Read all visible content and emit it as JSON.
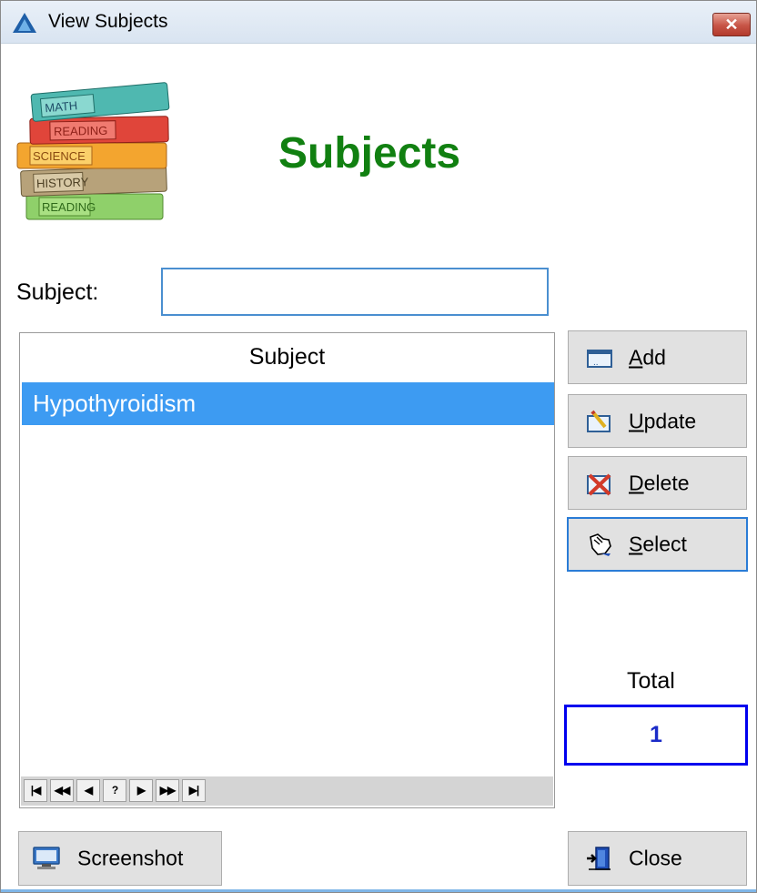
{
  "window": {
    "title": "View Subjects",
    "close_glyph": "✕"
  },
  "logo": {
    "book_labels": [
      "MATH",
      "READING",
      "SCIENCE",
      "HISTORY",
      "READING"
    ]
  },
  "heading": "Subjects",
  "subject_field": {
    "label": "Subject:",
    "value": "",
    "placeholder": ""
  },
  "grid": {
    "column_header": "Subject",
    "rows": [
      {
        "subject": "Hypothyroidism",
        "selected": true
      }
    ],
    "navigator": [
      "|◀",
      "◀◀",
      "◀",
      "?",
      "▶",
      "▶▶",
      "▶|"
    ]
  },
  "buttons": {
    "add": {
      "label": "Add",
      "accel": "A",
      "rest": "dd",
      "icon": "add-record-icon"
    },
    "update": {
      "label": "Update",
      "accel": "U",
      "rest": "pdate",
      "icon": "edit-pencil-icon"
    },
    "delete": {
      "label": "Delete",
      "accel": "D",
      "rest": "elete",
      "icon": "delete-x-icon"
    },
    "select": {
      "label": "Select",
      "accel": "S",
      "rest": "elect",
      "icon": "hand-pointer-icon"
    },
    "screenshot": {
      "label": "Screenshot",
      "icon": "monitor-icon"
    },
    "close": {
      "label": "Close",
      "icon": "exit-door-icon"
    }
  },
  "total": {
    "label": "Total",
    "value": "1"
  },
  "colors": {
    "heading": "#118011",
    "selection": "#3d9bf2",
    "total_value": "#1a2bc8",
    "total_border": "#0000ee",
    "focus_border": "#2a7cd6"
  }
}
